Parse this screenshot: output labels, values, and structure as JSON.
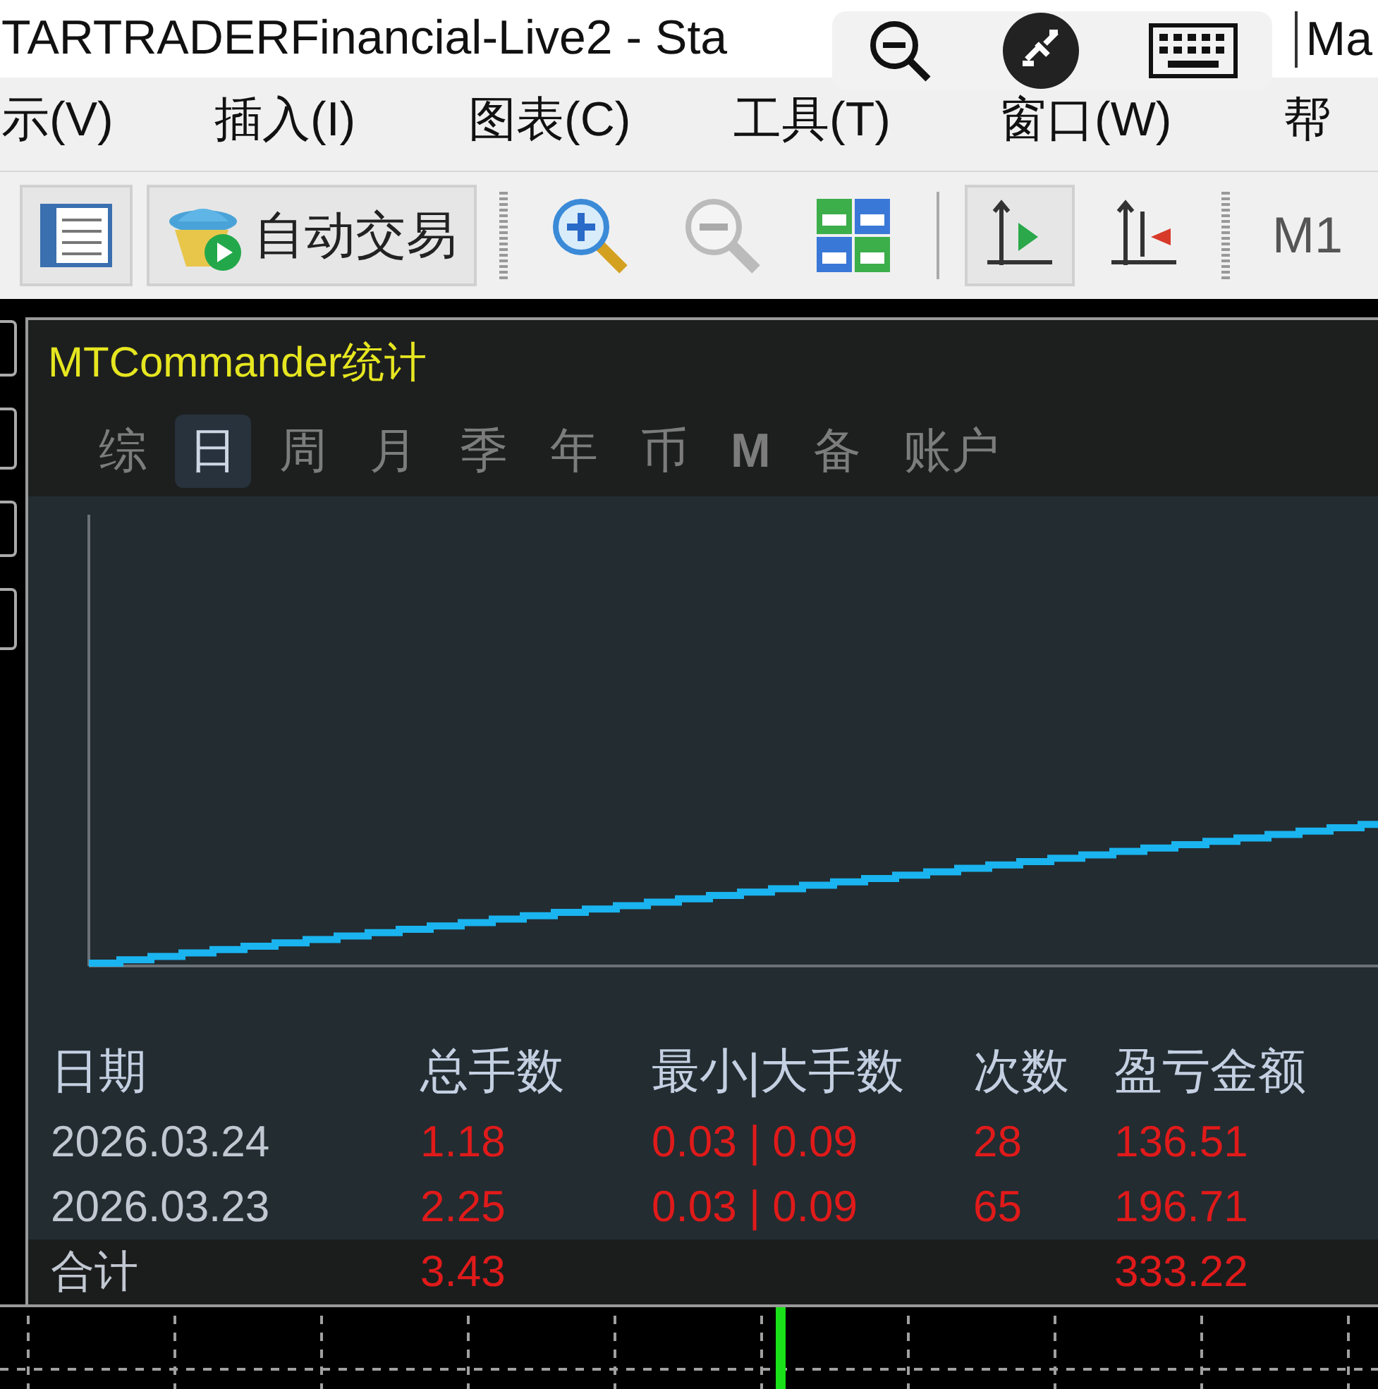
{
  "window": {
    "title": "TARTRADERFinancial-Live2 - Sta",
    "title_right": "Ma"
  },
  "menu": [
    {
      "label": "示(V)"
    },
    {
      "label": "插入(I)"
    },
    {
      "label": "图表(C)"
    },
    {
      "label": "工具(T)"
    },
    {
      "label": "窗口(W)"
    },
    {
      "label": "帮"
    }
  ],
  "toolbar": [
    {
      "kind": "list",
      "pressed": true
    },
    {
      "kind": "autotrade",
      "label": "自动交易",
      "pressed": true
    },
    {
      "kind": "grip"
    },
    {
      "kind": "zoom_in",
      "pressed": false
    },
    {
      "kind": "zoom_out",
      "pressed": false
    },
    {
      "kind": "tiles",
      "pressed": false
    },
    {
      "kind": "separator"
    },
    {
      "kind": "shift",
      "pressed": true
    },
    {
      "kind": "autoscroll",
      "pressed": false
    },
    {
      "kind": "grip"
    },
    {
      "kind": "text",
      "label": "M1",
      "pressed": false
    }
  ],
  "panel": {
    "title": "MTCommander统计",
    "tabs": [
      {
        "label": "综",
        "selected": false
      },
      {
        "label": "日",
        "selected": true
      },
      {
        "label": "周",
        "selected": false
      },
      {
        "label": "月",
        "selected": false
      },
      {
        "label": "季",
        "selected": false
      },
      {
        "label": "年",
        "selected": false
      },
      {
        "label": "币",
        "selected": false
      },
      {
        "label": "M",
        "selected": false
      },
      {
        "label": "备",
        "selected": false
      },
      {
        "label": "账户",
        "selected": false
      }
    ],
    "table": {
      "columns": [
        "日期",
        "总手数",
        "最小|大手数",
        "次数",
        "盈亏金额"
      ],
      "rows": [
        [
          "2026.03.24",
          "1.18",
          "0.03 | 0.09",
          "28",
          "136.51"
        ],
        [
          "2026.03.23",
          "2.25",
          "0.03 | 0.09",
          "65",
          "196.71"
        ]
      ],
      "total": {
        "label": "合计",
        "lots": "3.43",
        "pnl": "333.22"
      }
    }
  }
}
